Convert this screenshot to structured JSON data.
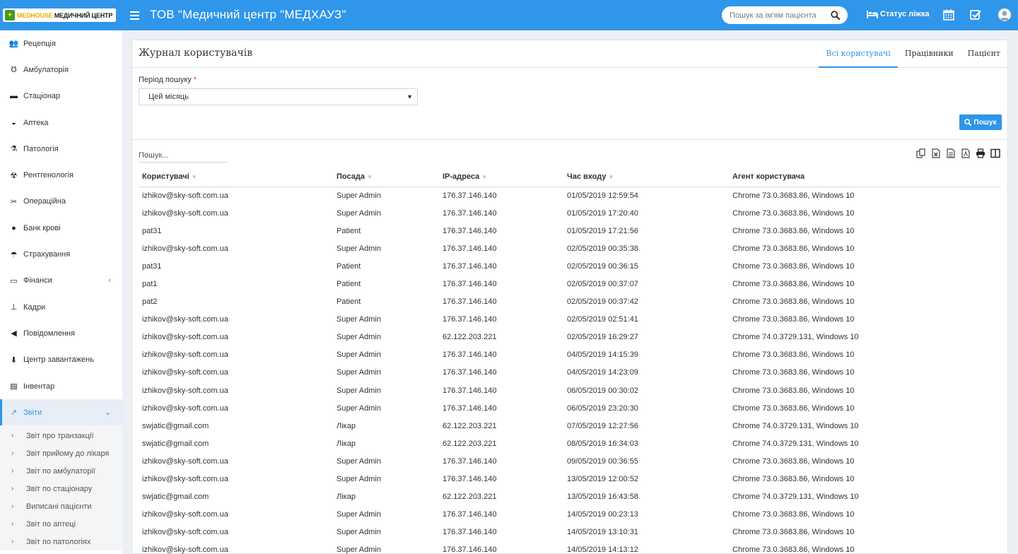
{
  "header": {
    "logo_brand": "MEDHOUSE",
    "logo_rest": " МЕДИЧНИЙ ЦЕНТР",
    "org_title": "ТОВ \"Медичний центр \"МЕДХАУЗ\"",
    "search_placeholder": "Пошук за ім'ям пацієнта",
    "bed_status_label": "Статус ліжка",
    "accent_color": "#2f96e9"
  },
  "sidebar": {
    "items": [
      {
        "label": "Рецепція",
        "icon": "reception-icon"
      },
      {
        "label": "Амбулаторія",
        "icon": "stethoscope-icon"
      },
      {
        "label": "Стаціонар",
        "icon": "bed-icon"
      },
      {
        "label": "Аптека",
        "icon": "mortar-icon"
      },
      {
        "label": "Патологія",
        "icon": "flask-icon"
      },
      {
        "label": "Рентгенологія",
        "icon": "xray-icon"
      },
      {
        "label": "Операційна",
        "icon": "scissors-icon"
      },
      {
        "label": "Банк крові",
        "icon": "drop-icon"
      },
      {
        "label": "Страхування",
        "icon": "umbrella-icon"
      },
      {
        "label": "Фінанси",
        "icon": "money-icon"
      },
      {
        "label": "Кадри",
        "icon": "sitemap-icon"
      },
      {
        "label": "Повідомлення",
        "icon": "bullhorn-icon"
      },
      {
        "label": "Центр завантажень",
        "icon": "download-icon"
      },
      {
        "label": "Інвентар",
        "icon": "inventory-icon"
      },
      {
        "label": "Звіти",
        "icon": "chart-icon"
      }
    ],
    "sub_items": [
      "Звіт про транзакції",
      "Звіт прийому до лікаря",
      "Звіт по амбулаторії",
      "Звіт по стаціонару",
      "Виписані пацієнти",
      "Звіт по аптеці",
      "Звіт по патологіях"
    ]
  },
  "panel": {
    "title": "Журнал користувачів",
    "tabs": [
      "Всі користувачі",
      "Працівники",
      "Пацієнт"
    ],
    "active_tab": "Всі користувачі",
    "period_label": "Період пошуку",
    "period_required_mark": "*",
    "period_value": "Цей місяць",
    "search_button": "Пошук",
    "table_search_placeholder": "Пошук..."
  },
  "table": {
    "columns": [
      "Користувачі",
      "Посада",
      "IP-адреса",
      "Час входу",
      "Агент користувача"
    ],
    "rows": [
      [
        "izhikov@sky-soft.com.ua",
        "Super Admin",
        "176.37.146.140",
        "01/05/2019 12:59:54",
        "Chrome 73.0.3683.86, Windows 10"
      ],
      [
        "izhikov@sky-soft.com.ua",
        "Super Admin",
        "176.37.146.140",
        "01/05/2019 17:20:40",
        "Chrome 73.0.3683.86, Windows 10"
      ],
      [
        "pat31",
        "Patient",
        "176.37.146.140",
        "01/05/2019 17:21:56",
        "Chrome 73.0.3683.86, Windows 10"
      ],
      [
        "izhikov@sky-soft.com.ua",
        "Super Admin",
        "176.37.146.140",
        "02/05/2019 00:35:38",
        "Chrome 73.0.3683.86, Windows 10"
      ],
      [
        "pat31",
        "Patient",
        "176.37.146.140",
        "02/05/2019 00:36:15",
        "Chrome 73.0.3683.86, Windows 10"
      ],
      [
        "pat1",
        "Patient",
        "176.37.146.140",
        "02/05/2019 00:37:07",
        "Chrome 73.0.3683.86, Windows 10"
      ],
      [
        "pat2",
        "Patient",
        "176.37.146.140",
        "02/05/2019 00:37:42",
        "Chrome 73.0.3683.86, Windows 10"
      ],
      [
        "izhikov@sky-soft.com.ua",
        "Super Admin",
        "176.37.146.140",
        "02/05/2019 02:51:41",
        "Chrome 73.0.3683.86, Windows 10"
      ],
      [
        "izhikov@sky-soft.com.ua",
        "Super Admin",
        "62.122.203.221",
        "02/05/2019 16:29:27",
        "Chrome 74.0.3729.131, Windows 10"
      ],
      [
        "izhikov@sky-soft.com.ua",
        "Super Admin",
        "176.37.146.140",
        "04/05/2019 14:15:39",
        "Chrome 73.0.3683.86, Windows 10"
      ],
      [
        "izhikov@sky-soft.com.ua",
        "Super Admin",
        "176.37.146.140",
        "04/05/2019 14:23:09",
        "Chrome 73.0.3683.86, Windows 10"
      ],
      [
        "izhikov@sky-soft.com.ua",
        "Super Admin",
        "176.37.146.140",
        "06/05/2019 00:30:02",
        "Chrome 73.0.3683.86, Windows 10"
      ],
      [
        "izhikov@sky-soft.com.ua",
        "Super Admin",
        "176.37.146.140",
        "06/05/2019 23:20:30",
        "Chrome 73.0.3683.86, Windows 10"
      ],
      [
        "swjatic@gmail.com",
        "Лікар",
        "62.122.203.221",
        "07/05/2019 12:27:56",
        "Chrome 74.0.3729.131, Windows 10"
      ],
      [
        "swjatic@gmail.com",
        "Лікар",
        "62.122.203.221",
        "08/05/2019 16:34:03",
        "Chrome 74.0.3729.131, Windows 10"
      ],
      [
        "izhikov@sky-soft.com.ua",
        "Super Admin",
        "176.37.146.140",
        "09/05/2019 00:36:55",
        "Chrome 73.0.3683.86, Windows 10"
      ],
      [
        "izhikov@sky-soft.com.ua",
        "Super Admin",
        "176.37.146.140",
        "13/05/2019 12:00:52",
        "Chrome 73.0.3683.86, Windows 10"
      ],
      [
        "swjatic@gmail.com",
        "Лікар",
        "62.122.203.221",
        "13/05/2019 16:43:58",
        "Chrome 74.0.3729.131, Windows 10"
      ],
      [
        "izhikov@sky-soft.com.ua",
        "Super Admin",
        "176.37.146.140",
        "14/05/2019 00:23:13",
        "Chrome 73.0.3683.86, Windows 10"
      ],
      [
        "izhikov@sky-soft.com.ua",
        "Super Admin",
        "176.37.146.140",
        "14/05/2019 13:10:31",
        "Chrome 73.0.3683.86, Windows 10"
      ],
      [
        "izhikov@sky-soft.com.ua",
        "Super Admin",
        "176.37.146.140",
        "14/05/2019 14:13:12",
        "Chrome 73.0.3683.86, Windows 10"
      ]
    ]
  }
}
